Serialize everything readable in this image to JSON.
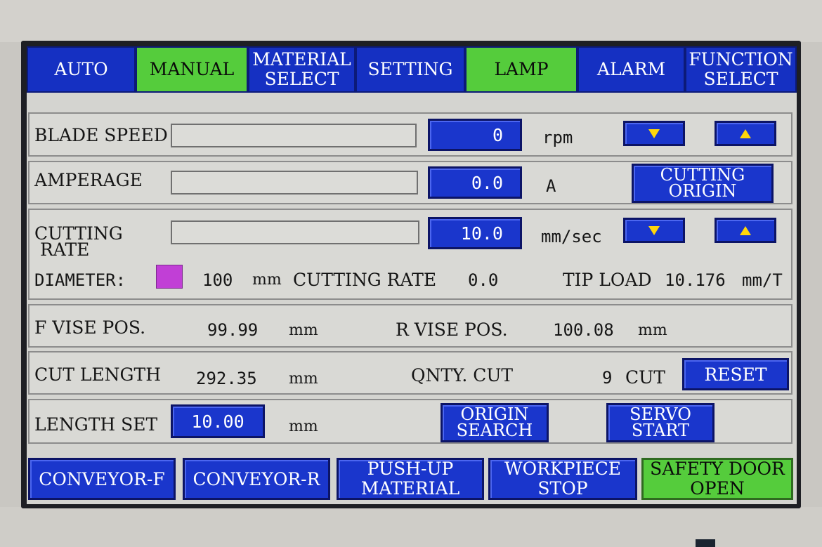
{
  "tabs": [
    {
      "label": "AUTO",
      "state": "blue"
    },
    {
      "label": "MANUAL",
      "state": "green"
    },
    {
      "label": "MATERIAL\nSELECT",
      "state": "blue"
    },
    {
      "label": "SETTING",
      "state": "blue"
    },
    {
      "label": "LAMP",
      "state": "green"
    },
    {
      "label": "ALARM",
      "state": "blue"
    },
    {
      "label": "FUNCTION\nSELECT",
      "state": "blue"
    }
  ],
  "blade_speed": {
    "label": "BLADE SPEED",
    "value": "0",
    "unit": "rpm",
    "level": 0
  },
  "amperage": {
    "label": "AMPERAGE",
    "value": "0.0",
    "unit": "A",
    "level": 0,
    "cutting_origin_label": "CUTTING\nORIGIN"
  },
  "cutting_rate": {
    "label": "CUTTING\n RATE",
    "value": "10.0",
    "unit": "mm/sec",
    "level": 0
  },
  "info_line": {
    "diameter_label": "DIAMETER:",
    "diameter_value": "100",
    "diameter_unit": "mm",
    "cutting_rate_label": "CUTTING RATE",
    "cutting_rate_value": "0.0",
    "tip_load_label": "TIP LOAD",
    "tip_load_value": "10.176",
    "tip_load_unit": "mm/T"
  },
  "vise": {
    "f_label": "F VISE POS.",
    "f_value": "99.99",
    "f_unit": "mm",
    "r_label": "R VISE POS.",
    "r_value": "100.08",
    "r_unit": "mm"
  },
  "cut": {
    "length_label": "CUT LENGTH",
    "length_value": "292.35",
    "length_unit": "mm",
    "qnty_label": "QNTY. CUT",
    "qnty_value": "9",
    "qnty_unit": "CUT",
    "reset_label": "RESET"
  },
  "length_set": {
    "label": "LENGTH SET",
    "value": "10.00",
    "unit": "mm",
    "origin_search_label": "ORIGIN\nSEARCH",
    "servo_start_label": "SERVO\nSTART"
  },
  "bottom_buttons": [
    {
      "label": "CONVEYOR-F",
      "state": "blue"
    },
    {
      "label": "CONVEYOR-R",
      "state": "blue"
    },
    {
      "label": "PUSH-UP\nMATERIAL",
      "state": "blue"
    },
    {
      "label": "WORKPIECE\nSTOP",
      "state": "blue"
    },
    {
      "label": "SAFETY DOOR\nOPEN",
      "state": "green"
    }
  ],
  "colors": {
    "button_blue": "#1a36cc",
    "active_green": "#55cc3c",
    "arrow_yellow": "#ffd60a",
    "diameter_swatch": "#c13fd6",
    "panel_bg": "#d4d4d0"
  },
  "icons": {
    "down": "triangle-down-icon",
    "up": "triangle-up-icon"
  }
}
